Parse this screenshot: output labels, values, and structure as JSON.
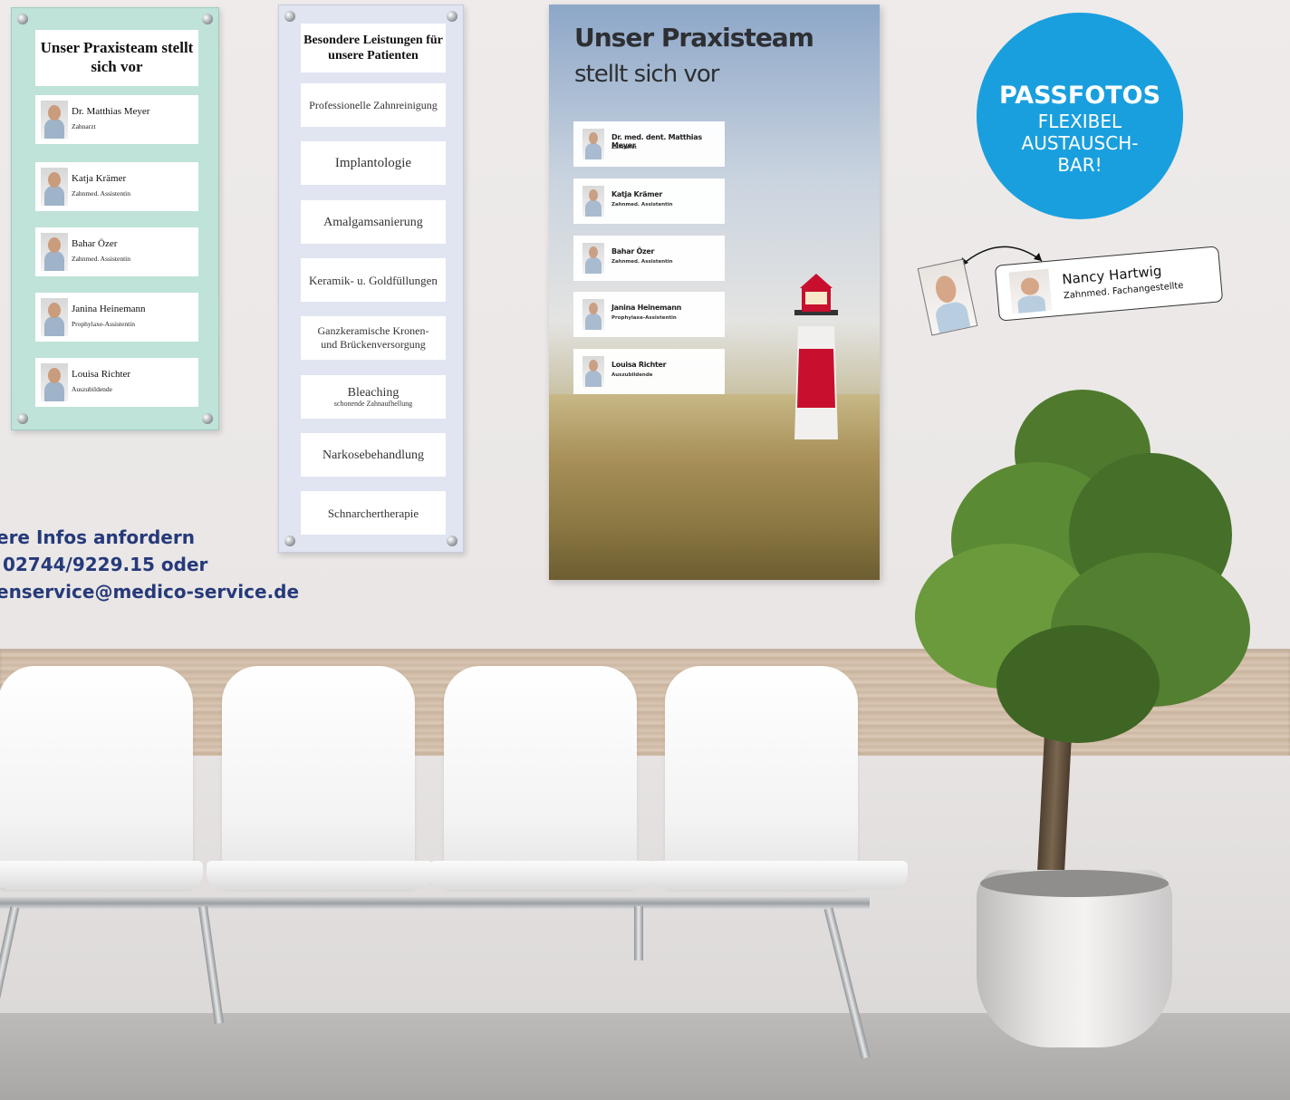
{
  "panel_team_acrylic": {
    "title": "Unser Praxisteam stellt sich vor",
    "members": [
      {
        "name": "Dr. Matthias Meyer",
        "role": "Zahnarzt"
      },
      {
        "name": "Katja Krämer",
        "role": "Zahnmed. Assistentin"
      },
      {
        "name": "Bahar Özer",
        "role": "Zahnmed. Assistentin"
      },
      {
        "name": "Janina Heinemann",
        "role": "Prophylaxe-Assistentin"
      },
      {
        "name": "Louisa Richter",
        "role": "Auszubildende"
      }
    ]
  },
  "panel_services": {
    "title": "Besondere Leistungen für unsere Patienten",
    "items": [
      {
        "label": "Professionelle Zahnreinigung",
        "sub": ""
      },
      {
        "label": "Implantologie",
        "sub": ""
      },
      {
        "label": "Amalgamsanierung",
        "sub": ""
      },
      {
        "label": "Keramik- u. Goldfüllungen",
        "sub": ""
      },
      {
        "label": "Ganzkeramische Kronen- und Brückenversorgung",
        "sub": ""
      },
      {
        "label": "Bleaching",
        "sub": "schonende Zahnaufhellung"
      },
      {
        "label": "Narkosebehandlung",
        "sub": ""
      },
      {
        "label": "Schnarchertherapie",
        "sub": ""
      }
    ]
  },
  "panel_lighthouse": {
    "title_line1": "Unser Praxisteam",
    "title_line2": "stellt sich vor",
    "members": [
      {
        "name": "Dr. med. dent. Matthias Meyer",
        "role": "Zahnarzt"
      },
      {
        "name": "Katja Krämer",
        "role": "Zahnmed. Assistentin"
      },
      {
        "name": "Bahar Özer",
        "role": "Zahnmed. Assistentin"
      },
      {
        "name": "Janina Heinemann",
        "role": "Prophylaxe-Assistentin"
      },
      {
        "name": "Louisa Richter",
        "role": "Auszubildende"
      }
    ]
  },
  "badge": {
    "line1": "PASSFOTOS",
    "line2": "FLEXIBEL",
    "line3": "AUSTAUSCH-",
    "line4": "BAR!",
    "color": "#1a9fde"
  },
  "name_card": {
    "name": "Nancy Hartwig",
    "role": "Zahnmed. Fachangestellte"
  },
  "contact": {
    "line1": "ere Infos anfordern",
    "line2": " 02744/9229.15 oder",
    "line3": "enservice@medico-service.de",
    "color": "#263a7a"
  }
}
